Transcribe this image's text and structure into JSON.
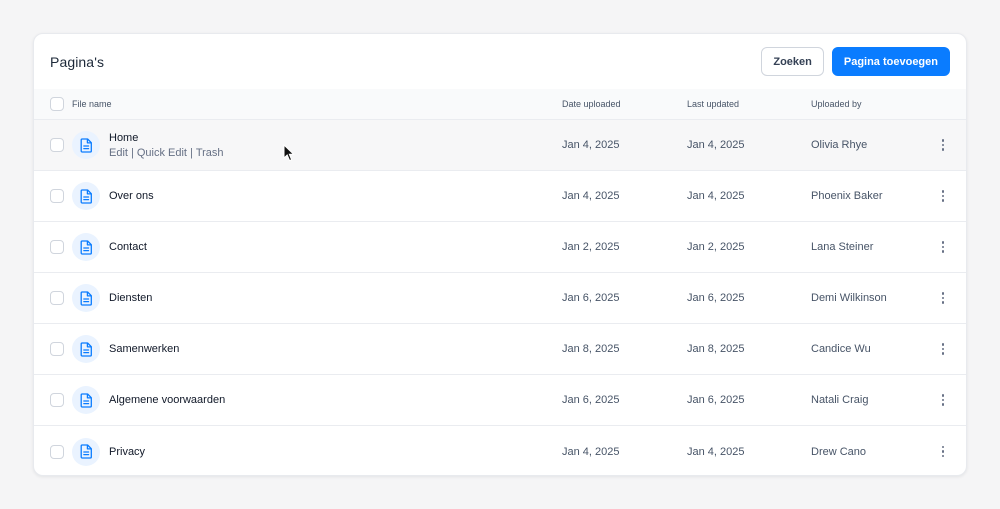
{
  "header": {
    "title": "Pagina's",
    "search_label": "Zoeken",
    "add_label": "Pagina toevoegen"
  },
  "columns": {
    "file_name": "File name",
    "date_uploaded": "Date uploaded",
    "last_updated": "Last updated",
    "uploaded_by": "Uploaded by"
  },
  "rows": [
    {
      "name": "Home",
      "date_uploaded": "Jan 4, 2025",
      "last_updated": "Jan 4, 2025",
      "uploaded_by": "Olivia Rhye"
    },
    {
      "name": "Over ons",
      "date_uploaded": "Jan 4, 2025",
      "last_updated": "Jan 4, 2025",
      "uploaded_by": "Phoenix Baker"
    },
    {
      "name": "Contact",
      "date_uploaded": "Jan 2, 2025",
      "last_updated": "Jan 2, 2025",
      "uploaded_by": "Lana Steiner"
    },
    {
      "name": "Diensten",
      "date_uploaded": "Jan 6, 2025",
      "last_updated": "Jan 6, 2025",
      "uploaded_by": "Demi Wilkinson"
    },
    {
      "name": "Samenwerken",
      "date_uploaded": "Jan 8, 2025",
      "last_updated": "Jan 8, 2025",
      "uploaded_by": "Candice Wu"
    },
    {
      "name": "Algemene voorwaarden",
      "date_uploaded": "Jan 6, 2025",
      "last_updated": "Jan 6, 2025",
      "uploaded_by": "Natali Craig"
    },
    {
      "name": "Privacy",
      "date_uploaded": "Jan 4, 2025",
      "last_updated": "Jan 4, 2025",
      "uploaded_by": "Drew Cano"
    }
  ],
  "hover_actions": {
    "edit": "Edit",
    "quick_edit": "Quick Edit",
    "trash": "Trash",
    "separator": "|"
  },
  "icons": {
    "row_icon": "file-icon",
    "row_menu": "more-vertical-icon",
    "pointer": "mouse-cursor"
  },
  "colors": {
    "primary": "#0a7cff",
    "icon_bg": "#eaf3ff",
    "page_bg": "#f5f5f6"
  }
}
